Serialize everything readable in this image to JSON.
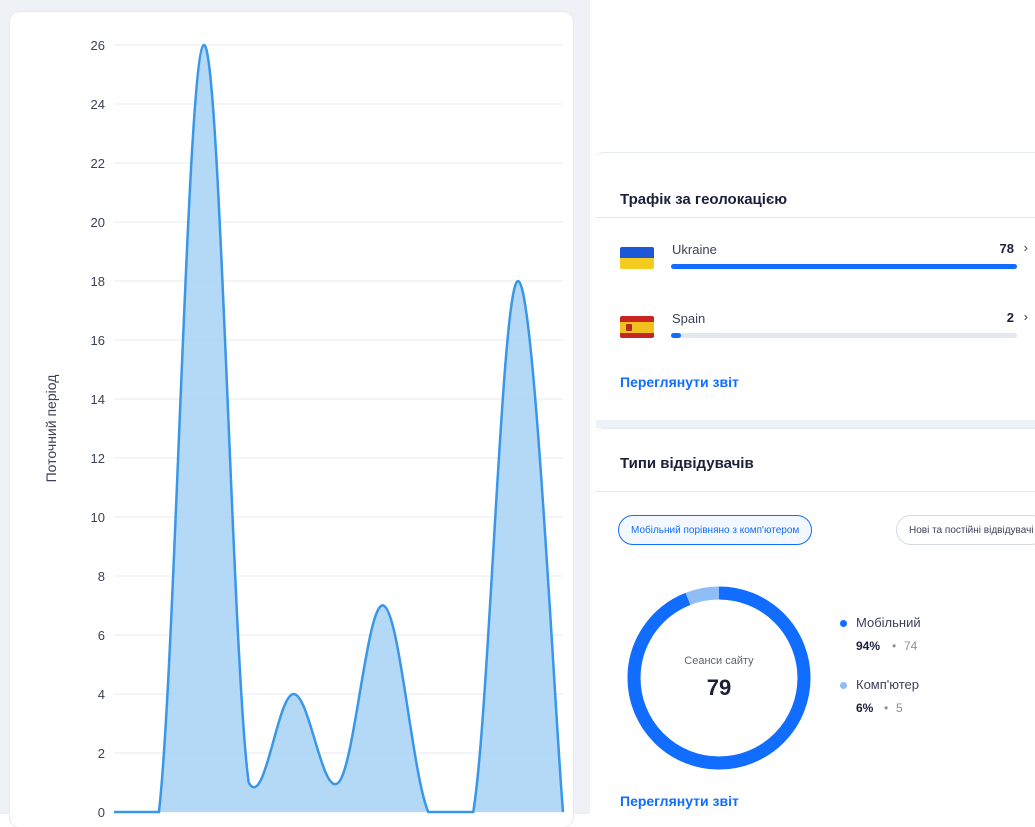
{
  "chart_data": {
    "type": "area",
    "ylabel": "Поточний період",
    "yticks": [
      "0",
      "2",
      "4",
      "6",
      "8",
      "10",
      "12",
      "14",
      "16",
      "18",
      "20",
      "22",
      "24",
      "26"
    ],
    "ylim": [
      0,
      26
    ],
    "grid": true,
    "series": [
      {
        "values": [
          0,
          0,
          26,
          1,
          4,
          1,
          7,
          0,
          0,
          18,
          0
        ]
      }
    ],
    "line_color": "#3a97e8",
    "fill_color": "#a6d2f6"
  },
  "geolocation": {
    "title": "Трафік за геолокацією",
    "rows": [
      {
        "country": "Ukraine",
        "count": "78",
        "chevron": "›",
        "share": 1.0,
        "flag_icon": "ukraine-flag-icon"
      },
      {
        "country": "Spain",
        "count": "2",
        "chevron": "›",
        "share": 0.03,
        "flag_icon": "spain-flag-icon"
      }
    ],
    "link": "Переглянути звіт"
  },
  "visitor_types": {
    "title": "Типи відвідувачів",
    "tabs": [
      {
        "label": "Мобільний порівняно з комп'ютером",
        "active": true
      },
      {
        "label": "Нові та постійні відвідувачі",
        "active": false
      }
    ],
    "donut": {
      "label": "Сеанси сайту",
      "value": "79",
      "mobile_fraction": 0.94,
      "desktop_fraction": 0.06
    },
    "legend": [
      {
        "name": "Мобільний",
        "pct": "94%",
        "sep": "•",
        "count": "74",
        "color": "#116dff"
      },
      {
        "name": "Комп'ютер",
        "pct": "6%",
        "sep": "•",
        "count": "5",
        "color": "#8fbdf7"
      }
    ],
    "link": "Переглянути звіт"
  },
  "colors": {
    "accent": "#116dff",
    "bar_track": "#e3e7ee"
  }
}
